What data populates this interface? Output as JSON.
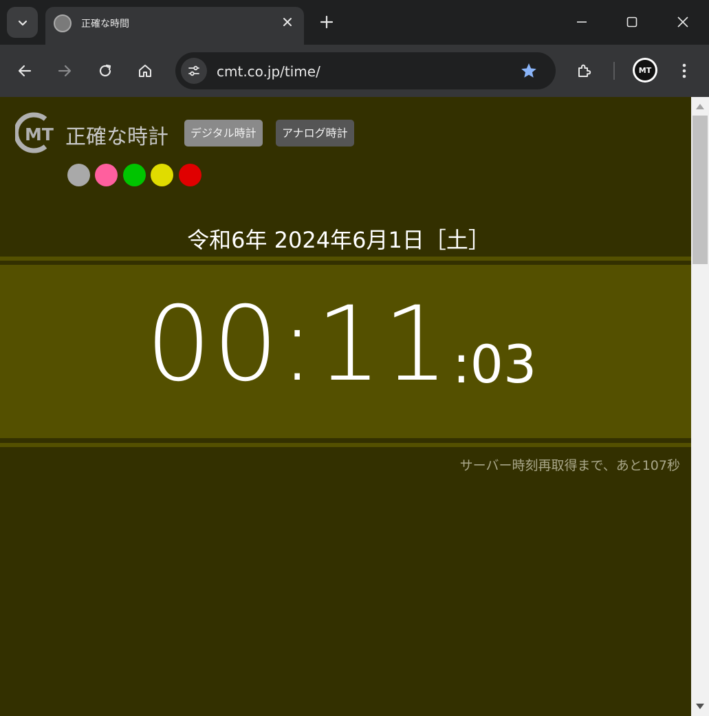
{
  "browser": {
    "tab_title": "正確な時間",
    "url": "cmt.co.jp/time/",
    "profile_initials": "MT"
  },
  "page": {
    "site_title": "正確な時計",
    "modes": {
      "digital": "デジタル時計",
      "analog": "アナログ時計"
    },
    "theme_colors": [
      "#a9a9a9",
      "#ff5f9e",
      "#00c400",
      "#e0dc00",
      "#e00000"
    ],
    "date_text": "令和6年 2024年6月1日［土］",
    "time_hm": "00:11",
    "time_seconds": ":03",
    "refresh_message": "サーバー時刻再取得まで、あと107秒",
    "background_color": "#333000",
    "band_color": "#545000"
  }
}
